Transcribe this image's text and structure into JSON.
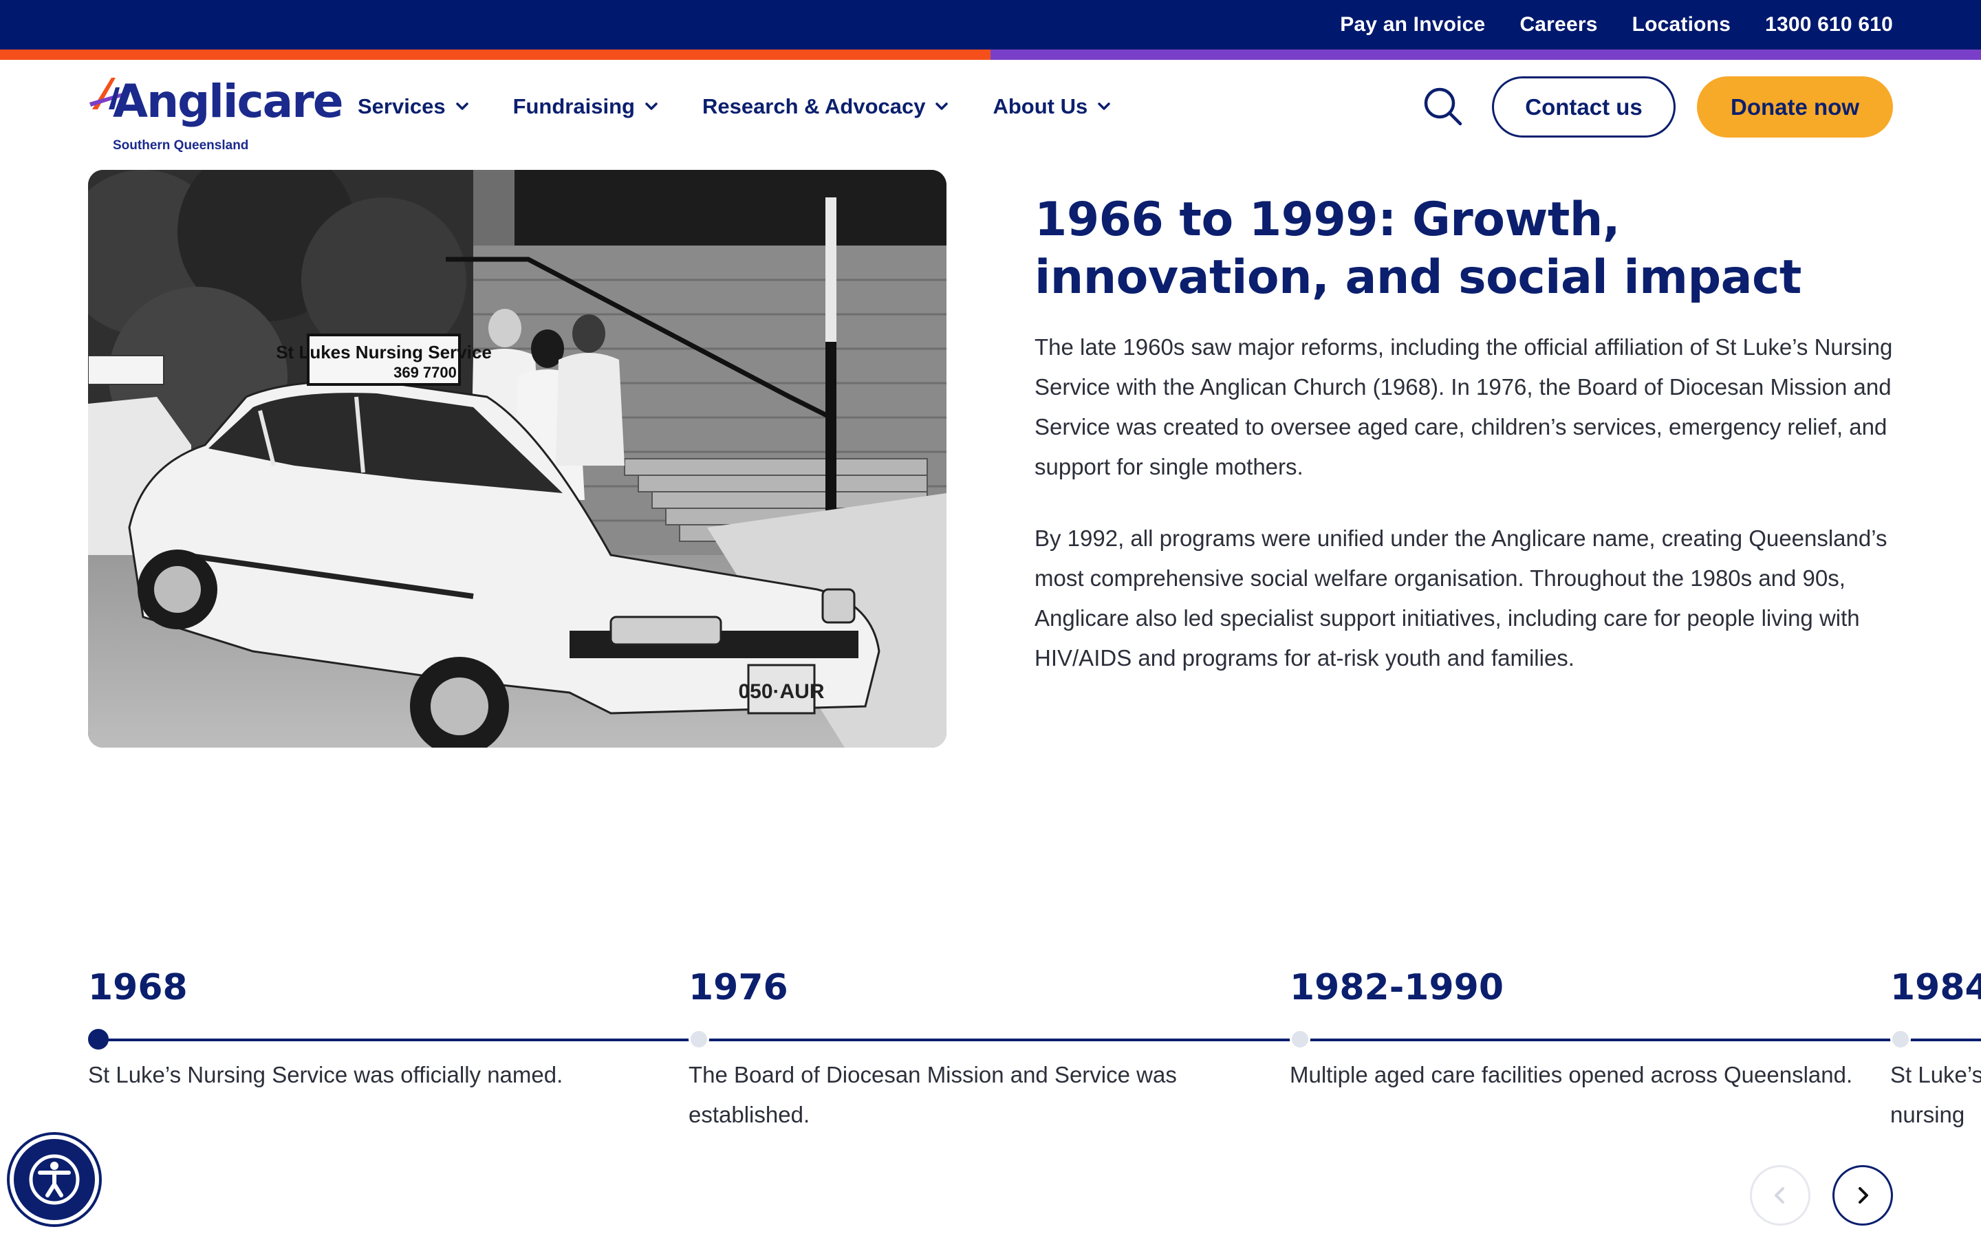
{
  "topbar": {
    "links": [
      "Pay an Invoice",
      "Careers",
      "Locations",
      "1300 610 610"
    ]
  },
  "brand": {
    "name": "Anglicare",
    "subtitle": "Southern Queensland",
    "colors": {
      "navy": "#00186e",
      "orange": "#f5501b",
      "purple": "#7a3fc8",
      "gold": "#f7a928"
    }
  },
  "nav": {
    "items": [
      "Services",
      "Fundraising",
      "Research & Advocacy",
      "About Us"
    ],
    "search_icon": "search-icon",
    "contact_label": "Contact us",
    "donate_label": "Donate now"
  },
  "section": {
    "heading": "1966 to 1999: Growth, innovation, and social impact",
    "paragraphs": [
      "The late 1960s saw major reforms, including the official affiliation of St Luke’s Nursing Service with the Anglican Church (1968). In 1976, the Board of Diocesan Mission and Service was created to oversee aged care, children’s services, emergency relief, and support for single mothers.",
      "By 1992, all programs were unified under the Anglicare name, creating Queensland’s most comprehensive social welfare organisation. Throughout the 1980s and 90s, Anglicare also led specialist support initiatives, including care for people living with HIV/AIDS and programs for at-risk youth and families."
    ],
    "photo": {
      "sign_title": "St Lukes Nursing Service",
      "sign_number": "369 7700",
      "plate": "050·AUR"
    }
  },
  "timeline": {
    "items": [
      {
        "year": "1968",
        "text": "St Luke’s Nursing Service was officially named."
      },
      {
        "year": "1976",
        "text": "The Board of Diocesan Mission and Service was established."
      },
      {
        "year": "1982-1990",
        "text": "Multiple aged care facilities opened across Queensland."
      },
      {
        "year": "1984",
        "text": "St Luke’s nursing"
      }
    ],
    "active_index": 0
  },
  "controls": {
    "prev_icon": "chevron-left-icon",
    "next_icon": "chevron-right-icon",
    "accessibility_icon": "accessibility-icon"
  }
}
